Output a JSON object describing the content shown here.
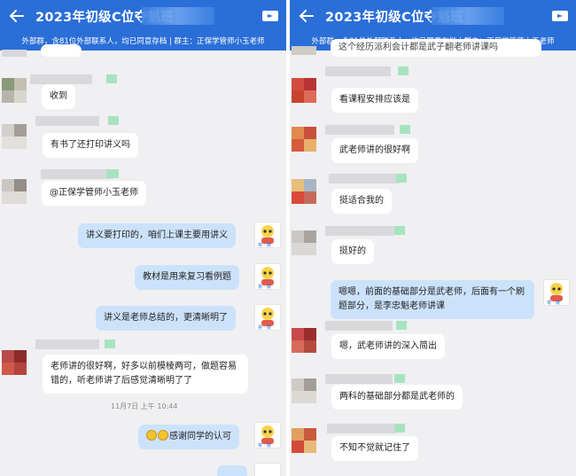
{
  "window": {
    "title": "2023年初级C位夺魁班",
    "subtitle": "外部群，含81位外部联系人，均已同意存档 | 群主：正保学管师小玉老师"
  },
  "colors": {
    "header": "#2a6ed8",
    "my_bubble": "#cce2fb",
    "their_bubble": "#ffffff",
    "background": "#f0f0f2"
  },
  "icons": {
    "back": "arrow-left-icon",
    "video": "video-camera-icon",
    "avatar_self": "cartoon-mascot-icon"
  },
  "left_chat": {
    "messages": [
      {
        "sender": "other",
        "text": "收到"
      },
      {
        "sender": "other",
        "text": "有书了还打印讲义吗"
      },
      {
        "sender": "other",
        "text": "@正保学管师小玉老师"
      },
      {
        "sender": "self",
        "text": "讲义要打印的，咱们上课主要用讲义"
      },
      {
        "sender": "self",
        "text": "教材是用来复习看例题"
      },
      {
        "sender": "self",
        "text": "讲义是老师总结的，更清晰明了"
      },
      {
        "sender": "other",
        "text": "老师讲的很好啊，好多以前模棱两可，做题容易错的，听老师讲了后感觉清晰明了了"
      },
      {
        "sender": "self",
        "text": "感谢同学的认可"
      }
    ],
    "timestamp": "11月7日  上午 10:44"
  },
  "right_chat": {
    "partial_top": "这个经历派利会计都是武子翻老师讲课吗",
    "messages": [
      {
        "sender": "other",
        "text": "看课程安排应该是"
      },
      {
        "sender": "other",
        "text": "武老师讲的很好啊"
      },
      {
        "sender": "other",
        "text": "挺适合我的"
      },
      {
        "sender": "other",
        "text": "挺好的"
      },
      {
        "sender": "self",
        "text": "嗯嗯，前面的基础部分是武老师，后面有一个刷题部分，是李忠魁老师讲课"
      },
      {
        "sender": "other",
        "text": "嗯，武老师讲的深入简出"
      },
      {
        "sender": "other",
        "text": "两科的基础部分都是武老师的"
      },
      {
        "sender": "other",
        "text": "不知不觉就记住了"
      }
    ]
  }
}
